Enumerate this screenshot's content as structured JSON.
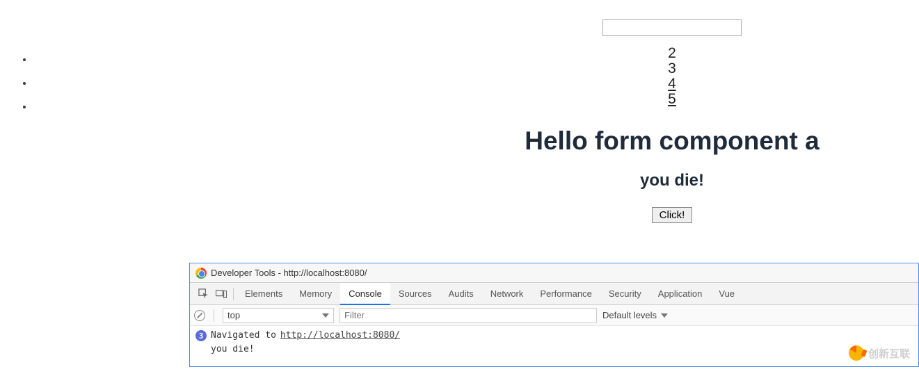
{
  "page": {
    "bullets": [
      "",
      "",
      ""
    ],
    "input_value": "",
    "numbers": [
      {
        "text": "2",
        "link": false
      },
      {
        "text": "3",
        "link": false
      },
      {
        "text": "4",
        "link": true
      },
      {
        "text": "5",
        "link": true
      }
    ],
    "heading_main": "Hello form component a",
    "heading_sub": "you die!",
    "button_label": "Click!"
  },
  "devtools": {
    "title": "Developer Tools - http://localhost:8080/",
    "tabs": [
      "Elements",
      "Memory",
      "Console",
      "Sources",
      "Audits",
      "Network",
      "Performance",
      "Security",
      "Application",
      "Vue"
    ],
    "active_tab": "Console",
    "context_label": "top",
    "filter_placeholder": "Filter",
    "levels_label": "Default levels",
    "log": {
      "nav_badge": "3",
      "nav_prefix": "Navigated to ",
      "nav_url": "http://localhost:8080/",
      "message": "you die!"
    }
  },
  "watermark": {
    "text": "创新互联"
  }
}
